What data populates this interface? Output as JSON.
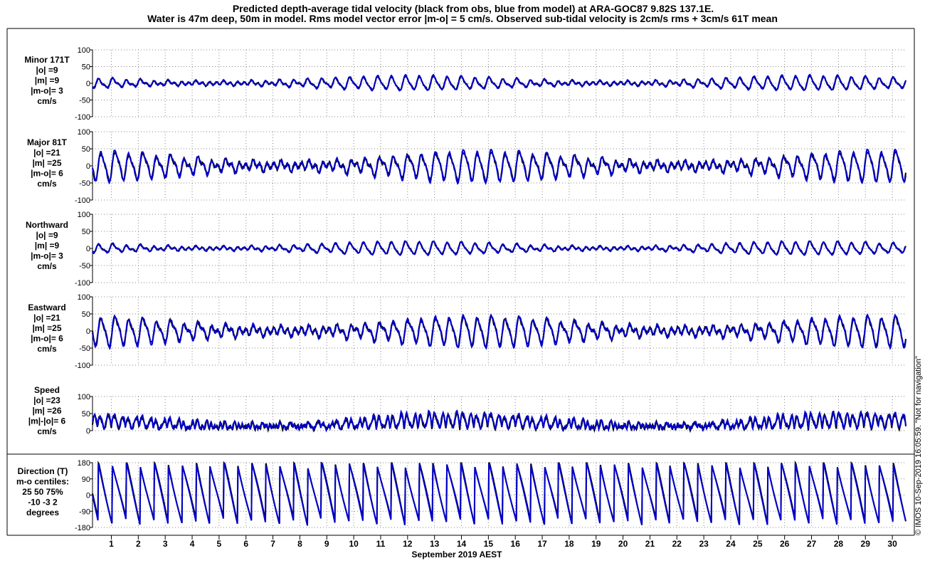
{
  "title": {
    "line1": "Predicted depth-average tidal velocity (black from obs, blue from model) at ARA-GOC87 9.82S 137.1E.",
    "line2": "Water is 47m deep, 50m in model. Rms model vector error |m-o| = 5 cm/s. Observed sub-tidal velocity is 2cm/s rms + 3cm/s 61T mean"
  },
  "xaxis": {
    "label": "September 2019 AEST",
    "days": [
      "1",
      "2",
      "3",
      "4",
      "5",
      "6",
      "7",
      "8",
      "9",
      "10",
      "11",
      "12",
      "13",
      "14",
      "15",
      "16",
      "17",
      "18",
      "19",
      "20",
      "21",
      "22",
      "23",
      "24",
      "25",
      "26",
      "27",
      "28",
      "29",
      "30"
    ],
    "range_days": [
      0.3,
      30.5
    ]
  },
  "side_note": "© IMOS 10-Sep-2019 16:05:59. \"Not for navigation\"",
  "colors": {
    "obs": "#000000",
    "model": "#0000cc",
    "grid": "#888888"
  },
  "panels": [
    {
      "id": "minor",
      "label_lines": [
        "Minor 171T",
        "|o| =9",
        "|m| =9",
        "|m-o|= 3",
        "cm/s"
      ],
      "ticks": [
        "100",
        "50",
        "0",
        "-50",
        "-100"
      ],
      "ylim": [
        -100,
        100
      ]
    },
    {
      "id": "major",
      "label_lines": [
        "Major 81T",
        "|o| =21",
        "|m| =25",
        "|m-o|= 6",
        "cm/s"
      ],
      "ticks": [
        "100",
        "50",
        "0",
        "-50",
        "-100"
      ],
      "ylim": [
        -100,
        100
      ]
    },
    {
      "id": "north",
      "label_lines": [
        "Northward",
        "|o| =9",
        "|m| =9",
        "|m-o|= 3",
        "cm/s"
      ],
      "ticks": [
        "100",
        "50",
        "0",
        "-50",
        "-100"
      ],
      "ylim": [
        -100,
        100
      ]
    },
    {
      "id": "east",
      "label_lines": [
        "Eastward",
        "|o| =21",
        "|m| =25",
        "|m-o|= 6",
        "cm/s"
      ],
      "ticks": [
        "100",
        "50",
        "0",
        "-50",
        "-100"
      ],
      "ylim": [
        -100,
        100
      ]
    },
    {
      "id": "speed",
      "label_lines": [
        "Speed",
        "|o| =23",
        "|m| =26",
        "|m|-|o|= 6",
        "cm/s"
      ],
      "ticks": [
        "100",
        "50",
        "0"
      ],
      "ylim": [
        0,
        100
      ]
    },
    {
      "id": "direction",
      "label_lines": [
        "Direction (T)",
        "m-o centiles:",
        "25  50  75%",
        "-10 -3  2",
        "degrees"
      ],
      "ticks": [
        "180",
        "90",
        "0",
        "-90",
        "-180"
      ],
      "ylim": [
        -180,
        180
      ]
    }
  ],
  "chart_data": {
    "type": "line",
    "x_unit": "day of September 2019 (AEST)",
    "x_range": [
      0.3,
      30.5
    ],
    "series_names": [
      "obs",
      "model"
    ],
    "panel_amplitudes_cm_s": {
      "minor": {
        "obs": 9,
        "model": 9,
        "diff": 3
      },
      "major": {
        "obs": 21,
        "model": 25,
        "diff": 6
      },
      "north": {
        "obs": 9,
        "model": 9,
        "diff": 3
      },
      "east": {
        "obs": 21,
        "model": 25,
        "diff": 6
      },
      "speed": {
        "obs": 23,
        "model": 26,
        "diff": 6
      }
    },
    "direction_centiles_deg": {
      "p25": -10,
      "p50": -3,
      "p75": 2
    },
    "approx_peak_amplitude_cm_s": {
      "minor": 20,
      "major": 42,
      "north": 18,
      "east": 42,
      "speed": 50
    }
  }
}
